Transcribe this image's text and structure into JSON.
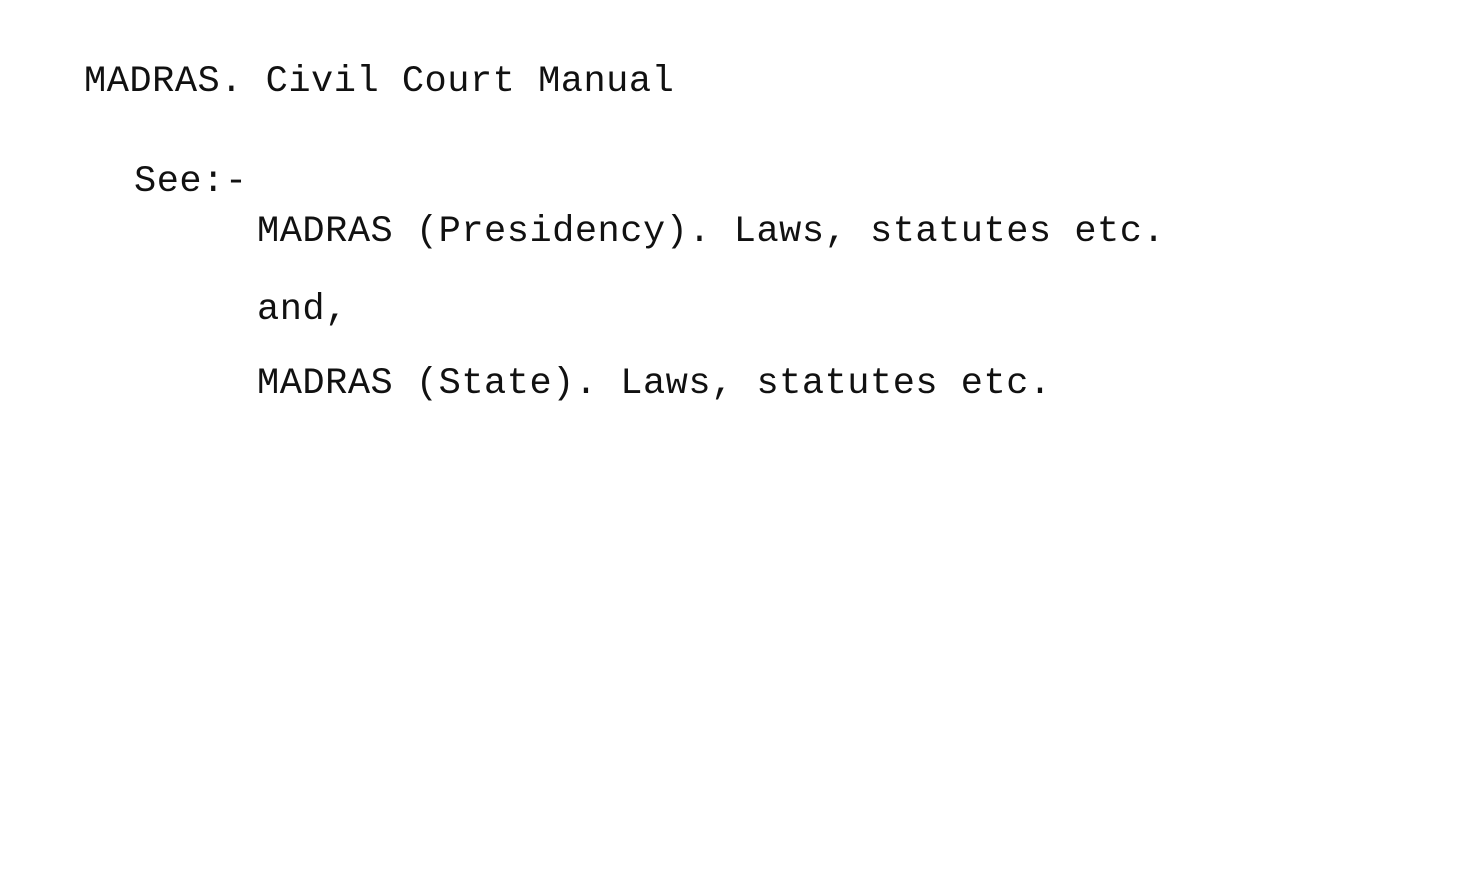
{
  "card": {
    "heading": "MADRAS. Civil Court Manual",
    "see_label": "See:-",
    "references": [
      "MADRAS (Presidency). Laws, statutes etc.",
      "MADRAS (State). Laws, statutes etc."
    ],
    "conjunction": "and,"
  }
}
